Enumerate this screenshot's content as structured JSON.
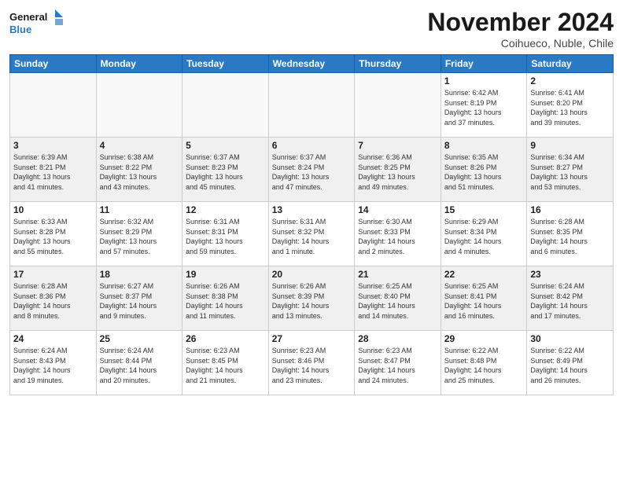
{
  "logo": {
    "line1": "General",
    "line2": "Blue"
  },
  "title": "November 2024",
  "location": "Coihueco, Nuble, Chile",
  "weekdays": [
    "Sunday",
    "Monday",
    "Tuesday",
    "Wednesday",
    "Thursday",
    "Friday",
    "Saturday"
  ],
  "weeks": [
    [
      {
        "day": "",
        "info": ""
      },
      {
        "day": "",
        "info": ""
      },
      {
        "day": "",
        "info": ""
      },
      {
        "day": "",
        "info": ""
      },
      {
        "day": "",
        "info": ""
      },
      {
        "day": "1",
        "info": "Sunrise: 6:42 AM\nSunset: 8:19 PM\nDaylight: 13 hours\nand 37 minutes."
      },
      {
        "day": "2",
        "info": "Sunrise: 6:41 AM\nSunset: 8:20 PM\nDaylight: 13 hours\nand 39 minutes."
      }
    ],
    [
      {
        "day": "3",
        "info": "Sunrise: 6:39 AM\nSunset: 8:21 PM\nDaylight: 13 hours\nand 41 minutes."
      },
      {
        "day": "4",
        "info": "Sunrise: 6:38 AM\nSunset: 8:22 PM\nDaylight: 13 hours\nand 43 minutes."
      },
      {
        "day": "5",
        "info": "Sunrise: 6:37 AM\nSunset: 8:23 PM\nDaylight: 13 hours\nand 45 minutes."
      },
      {
        "day": "6",
        "info": "Sunrise: 6:37 AM\nSunset: 8:24 PM\nDaylight: 13 hours\nand 47 minutes."
      },
      {
        "day": "7",
        "info": "Sunrise: 6:36 AM\nSunset: 8:25 PM\nDaylight: 13 hours\nand 49 minutes."
      },
      {
        "day": "8",
        "info": "Sunrise: 6:35 AM\nSunset: 8:26 PM\nDaylight: 13 hours\nand 51 minutes."
      },
      {
        "day": "9",
        "info": "Sunrise: 6:34 AM\nSunset: 8:27 PM\nDaylight: 13 hours\nand 53 minutes."
      }
    ],
    [
      {
        "day": "10",
        "info": "Sunrise: 6:33 AM\nSunset: 8:28 PM\nDaylight: 13 hours\nand 55 minutes."
      },
      {
        "day": "11",
        "info": "Sunrise: 6:32 AM\nSunset: 8:29 PM\nDaylight: 13 hours\nand 57 minutes."
      },
      {
        "day": "12",
        "info": "Sunrise: 6:31 AM\nSunset: 8:31 PM\nDaylight: 13 hours\nand 59 minutes."
      },
      {
        "day": "13",
        "info": "Sunrise: 6:31 AM\nSunset: 8:32 PM\nDaylight: 14 hours\nand 1 minute."
      },
      {
        "day": "14",
        "info": "Sunrise: 6:30 AM\nSunset: 8:33 PM\nDaylight: 14 hours\nand 2 minutes."
      },
      {
        "day": "15",
        "info": "Sunrise: 6:29 AM\nSunset: 8:34 PM\nDaylight: 14 hours\nand 4 minutes."
      },
      {
        "day": "16",
        "info": "Sunrise: 6:28 AM\nSunset: 8:35 PM\nDaylight: 14 hours\nand 6 minutes."
      }
    ],
    [
      {
        "day": "17",
        "info": "Sunrise: 6:28 AM\nSunset: 8:36 PM\nDaylight: 14 hours\nand 8 minutes."
      },
      {
        "day": "18",
        "info": "Sunrise: 6:27 AM\nSunset: 8:37 PM\nDaylight: 14 hours\nand 9 minutes."
      },
      {
        "day": "19",
        "info": "Sunrise: 6:26 AM\nSunset: 8:38 PM\nDaylight: 14 hours\nand 11 minutes."
      },
      {
        "day": "20",
        "info": "Sunrise: 6:26 AM\nSunset: 8:39 PM\nDaylight: 14 hours\nand 13 minutes."
      },
      {
        "day": "21",
        "info": "Sunrise: 6:25 AM\nSunset: 8:40 PM\nDaylight: 14 hours\nand 14 minutes."
      },
      {
        "day": "22",
        "info": "Sunrise: 6:25 AM\nSunset: 8:41 PM\nDaylight: 14 hours\nand 16 minutes."
      },
      {
        "day": "23",
        "info": "Sunrise: 6:24 AM\nSunset: 8:42 PM\nDaylight: 14 hours\nand 17 minutes."
      }
    ],
    [
      {
        "day": "24",
        "info": "Sunrise: 6:24 AM\nSunset: 8:43 PM\nDaylight: 14 hours\nand 19 minutes."
      },
      {
        "day": "25",
        "info": "Sunrise: 6:24 AM\nSunset: 8:44 PM\nDaylight: 14 hours\nand 20 minutes."
      },
      {
        "day": "26",
        "info": "Sunrise: 6:23 AM\nSunset: 8:45 PM\nDaylight: 14 hours\nand 21 minutes."
      },
      {
        "day": "27",
        "info": "Sunrise: 6:23 AM\nSunset: 8:46 PM\nDaylight: 14 hours\nand 23 minutes."
      },
      {
        "day": "28",
        "info": "Sunrise: 6:23 AM\nSunset: 8:47 PM\nDaylight: 14 hours\nand 24 minutes."
      },
      {
        "day": "29",
        "info": "Sunrise: 6:22 AM\nSunset: 8:48 PM\nDaylight: 14 hours\nand 25 minutes."
      },
      {
        "day": "30",
        "info": "Sunrise: 6:22 AM\nSunset: 8:49 PM\nDaylight: 14 hours\nand 26 minutes."
      }
    ]
  ]
}
